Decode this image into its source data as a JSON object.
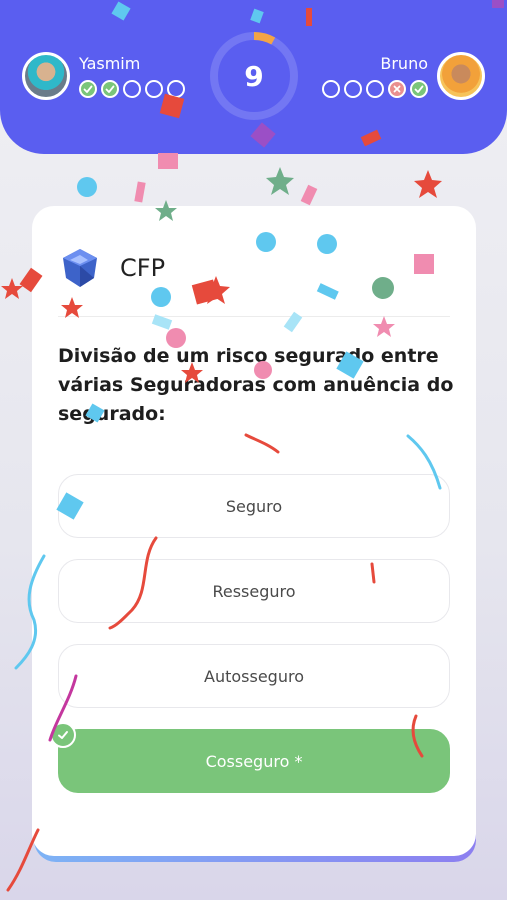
{
  "players": {
    "left": {
      "name": "Yasmim",
      "answers": [
        "correct",
        "correct",
        "empty",
        "empty",
        "empty"
      ]
    },
    "right": {
      "name": "Bruno",
      "answers": [
        "empty",
        "empty",
        "empty",
        "wrong",
        "correct"
      ]
    }
  },
  "timer": {
    "value": "9",
    "progress": 0.08
  },
  "card": {
    "subject": {
      "name": "CFP",
      "icon": "diamond-icon"
    },
    "question": "Divisão de um risco segurado entre várias Seguradoras com anuência do segurado:",
    "options": [
      {
        "label": "Seguro",
        "state": "default"
      },
      {
        "label": "Resseguro",
        "state": "default"
      },
      {
        "label": "Autosseguro",
        "state": "default"
      },
      {
        "label": "Cosseguro *",
        "state": "correct"
      }
    ]
  },
  "colors": {
    "header": "#5a5ef0",
    "correct": "#7ac57a",
    "wrong": "#e98f8f",
    "timer_accent": "#f3a446"
  }
}
